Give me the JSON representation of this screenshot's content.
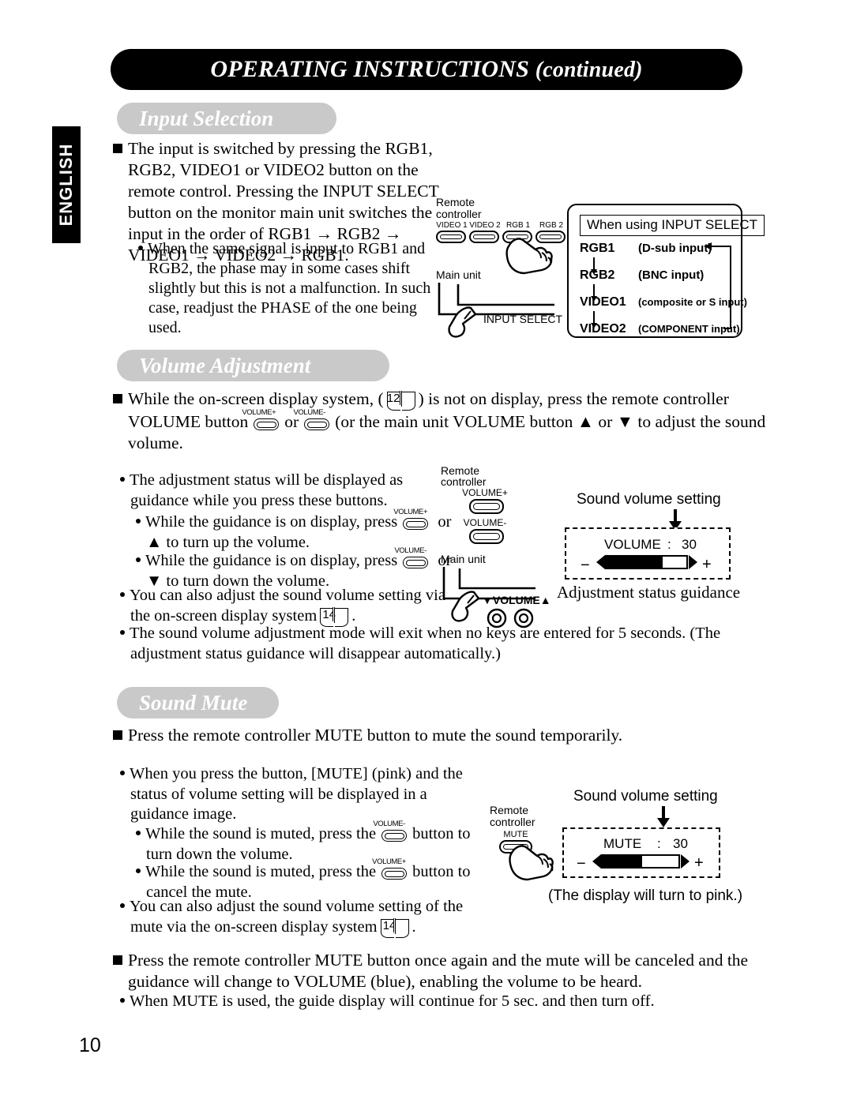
{
  "page": {
    "title": "OPERATING INSTRUCTIONS",
    "title_suffix": "(continued)",
    "language_tab": "ENGLISH",
    "page_number": "10"
  },
  "input_selection": {
    "heading": "Input Selection",
    "main_bullet_lines": [
      "The input is switched by pressing the RGB1, RGB2, VIDEO1 or VIDEO2 button",
      "on the remote control. Pressing the INPUT SELECT button on the monitor main",
      "unit switches the input in the order of",
      "RGB1 → RGB2 → VIDEO1 →",
      "VIDEO2 → RGB1."
    ],
    "sub_bullet_lines": [
      "When the same signal is input to RGB1 and",
      "RGB2, the phase may in some cases shift",
      "slightly but this is not a malfunction. In such",
      "case, readjust the PHASE of the one being",
      "used."
    ],
    "figure": {
      "remote_label_line1": "Remote",
      "remote_label_line2": "controller",
      "remote_buttons": [
        "VIDEO 1",
        "VIDEO 2",
        "RGB 1",
        "RGB 2"
      ],
      "main_unit_label": "Main unit",
      "input_select_label": "INPUT SELECT"
    },
    "panel": {
      "header": "When using INPUT SELECT",
      "rows": [
        {
          "name": "RGB1",
          "desc": "(D-sub input)"
        },
        {
          "name": "RGB2",
          "desc": "(BNC input)"
        },
        {
          "name": "VIDEO1",
          "desc": "(composite or S input)"
        },
        {
          "name": "VIDEO2",
          "desc": "(COMPONENT input)"
        }
      ]
    }
  },
  "volume_adjustment": {
    "heading": "Volume Adjustment",
    "intro": {
      "l1_a": "While the on-screen display system, (",
      "l1_page_ref": "12",
      "l1_b": ") is not on display, press the remote",
      "l2_a": "controller VOLUME button",
      "l2_key1": "VOLUME+",
      "l2_or": "or",
      "l2_key2": "VOLUME-",
      "l2_b": "(or the main unit VOLUME button ▲ or",
      "l3": "▼ to adjust the sound volume."
    },
    "bullets": [
      {
        "indent": 0,
        "lines": [
          "The adjustment status will be displayed as",
          "guidance while you press these buttons."
        ]
      },
      {
        "indent": 1,
        "lines": [
          "While the guidance is on display, press",
          "or ▲ to turn up the volume."
        ],
        "key": "VOLUME+"
      },
      {
        "indent": 1,
        "lines": [
          "While the guidance is on display, press",
          "or ▼ to turn down the volume."
        ],
        "key": "VOLUME-"
      },
      {
        "indent": 0,
        "lines": [
          "You can also adjust the sound volume setting",
          "via the on-screen display system"
        ],
        "page_ref": "14"
      },
      {
        "indent": 0,
        "lines": [
          "The sound volume adjustment mode will exit",
          "when no keys are entered for 5 seconds.  (The adjustment status guidance will disappear",
          "automatically.)"
        ]
      }
    ],
    "figure": {
      "remote_label_line1": "Remote",
      "remote_label_line2": "controller",
      "key_plus": "VOLUME+",
      "key_minus": "VOLUME-",
      "main_unit_label": "Main unit",
      "unit_buttons_label": "▼VOLUME▲",
      "osd_title": "Sound volume setting",
      "osd_item": "VOLUME",
      "osd_colon": ":",
      "osd_value": "30",
      "osd_minus": "−",
      "osd_plus": "+",
      "osd_fill_percent": 70,
      "caption": "Adjustment status guidance"
    }
  },
  "sound_mute": {
    "heading": "Sound Mute",
    "main_bullet": "Press the remote controller MUTE button to mute the sound temporarily.",
    "bullets": [
      {
        "indent": 0,
        "lines": [
          "When you press the button, [MUTE] (pink) and the",
          "status of volume setting will be displayed in a",
          "guidance image."
        ]
      },
      {
        "indent": 1,
        "lines": [
          "While the sound is muted, press the",
          "to turn down the volume."
        ],
        "key": "VOLUME-",
        "key_suffix": "button"
      },
      {
        "indent": 1,
        "lines": [
          "While the sound is muted, press the",
          "to cancel the mute."
        ],
        "key": "VOLUME+",
        "key_suffix": "button"
      },
      {
        "indent": 0,
        "lines": [
          "You can also adjust the sound volume setting of the",
          "mute via the on-screen display system"
        ],
        "page_ref": "14"
      }
    ],
    "figure": {
      "remote_label_line1": "Remote",
      "remote_label_line2": "controller",
      "mute_key": "MUTE",
      "osd_title": "Sound volume setting",
      "osd_item": "MUTE",
      "osd_colon": ":",
      "osd_value": "30",
      "osd_minus": "−",
      "osd_plus": "+",
      "osd_fill_percent": 52,
      "caption": "(The display will turn to pink.)"
    },
    "closing": {
      "lines": [
        "Press the remote controller MUTE button once again and the mute will be canceled and",
        "the guidance will change to VOLUME (blue), enabling the volume to be heard."
      ],
      "note": "When MUTE is used, the guide display will continue for 5 sec. and then turn off."
    }
  }
}
